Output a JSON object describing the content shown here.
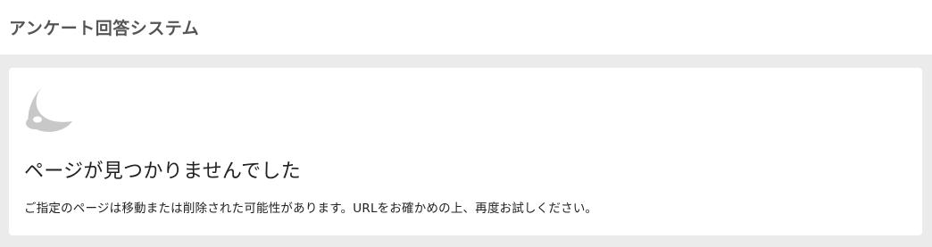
{
  "header": {
    "title": "アンケート回答システム"
  },
  "error": {
    "icon": "crescent-moon-icon",
    "heading": "ページが見つかりませんでした",
    "message": "ご指定のページは移動または削除された可能性があります。URLをお確かめの上、再度お試しください。"
  },
  "colors": {
    "background": "#ebebeb",
    "panel": "#ffffff",
    "header_text": "#555555",
    "icon": "#c8c8c8"
  }
}
